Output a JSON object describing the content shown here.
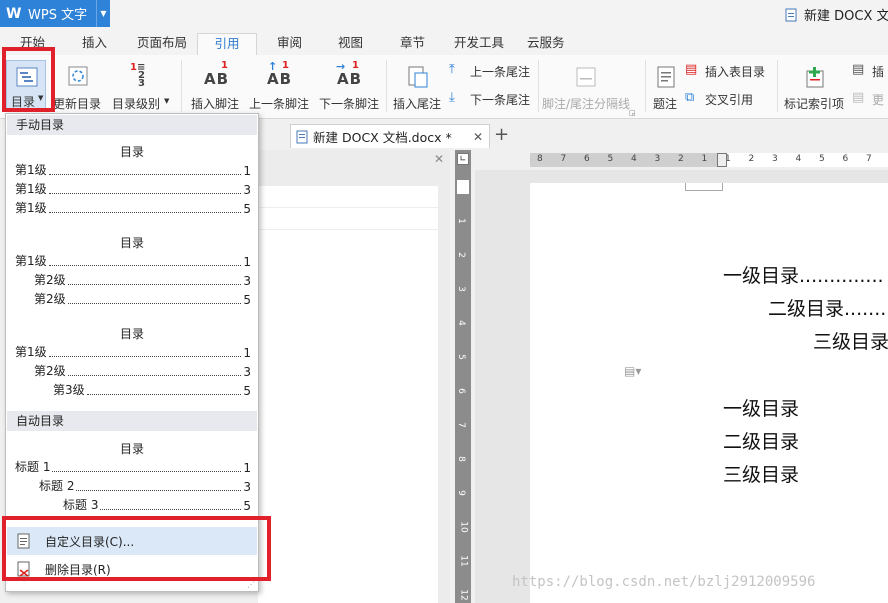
{
  "app": {
    "name": "WPS 文字",
    "logo": "W"
  },
  "window": {
    "doc_title": "新建 DOCX 文"
  },
  "tabs": [
    "开始",
    "插入",
    "页面布局",
    "引用",
    "审阅",
    "视图",
    "章节",
    "开发工具",
    "云服务"
  ],
  "ribbon": {
    "toc": "目录",
    "update_toc": "更新目录",
    "toc_level": "目录级别",
    "insert_footnote": "插入脚注",
    "prev_footnote": "上一条脚注",
    "next_footnote": "下一条脚注",
    "insert_endnote": "插入尾注",
    "prev_endnote": "上一条尾注",
    "next_endnote": "下一条尾注",
    "separator": "脚注/尾注分隔线",
    "caption": "题注",
    "insert_table_toc": "插入表目录",
    "cross_ref": "交叉引用",
    "mark_index": "标记索引项",
    "insert_index_partial": "插",
    "update_index_partial": "更",
    "glyph_ab": "AB",
    "glyph_one": "1",
    "glyph_two": "2",
    "glyph_three": "3"
  },
  "doc_tab": {
    "title": "新建 DOCX 文档.docx *",
    "close": "✕",
    "new": "+"
  },
  "dropdown": {
    "manual_header": "手动目录",
    "auto_header": "自动目录",
    "toc_heading": "目录",
    "t1": [
      {
        "label": "第1级",
        "num": "1"
      },
      {
        "label": "第1级",
        "num": "3"
      },
      {
        "label": "第1级",
        "num": "5"
      }
    ],
    "t2": [
      {
        "label": "第1级",
        "num": "1"
      },
      {
        "label": "第2级",
        "num": "3"
      },
      {
        "label": "第2级",
        "num": "5"
      }
    ],
    "t3": [
      {
        "label": "第1级",
        "num": "1"
      },
      {
        "label": "第2级",
        "num": "3"
      },
      {
        "label": "第3级",
        "num": "5"
      }
    ],
    "t4": [
      {
        "label": "标题 1",
        "num": "1"
      },
      {
        "label": "标题 2",
        "num": "3"
      },
      {
        "label": "标题 3",
        "num": "5"
      }
    ],
    "custom_toc": "自定义目录(C)...",
    "delete_toc": "删除目录(R)"
  },
  "ruler": {
    "h_ticks": [
      "8",
      "7",
      "6",
      "5",
      "4",
      "3",
      "2",
      "1",
      "1",
      "2",
      "3",
      "4",
      "5",
      "6",
      "7"
    ],
    "v_ticks": [
      "1",
      "1",
      "2",
      "3",
      "4",
      "5",
      "6",
      "7",
      "8",
      "9",
      "10",
      "11",
      "12"
    ]
  },
  "page": {
    "lines": [
      "一级目录..............",
      "二级目录........",
      "三级目录",
      "一级目录",
      "二级目录",
      "三级目录"
    ]
  },
  "watermark": "https://blog.csdn.net/bzlj2912009596",
  "colors": {
    "accent": "#2e82d7",
    "highlight": "#e0202a"
  }
}
